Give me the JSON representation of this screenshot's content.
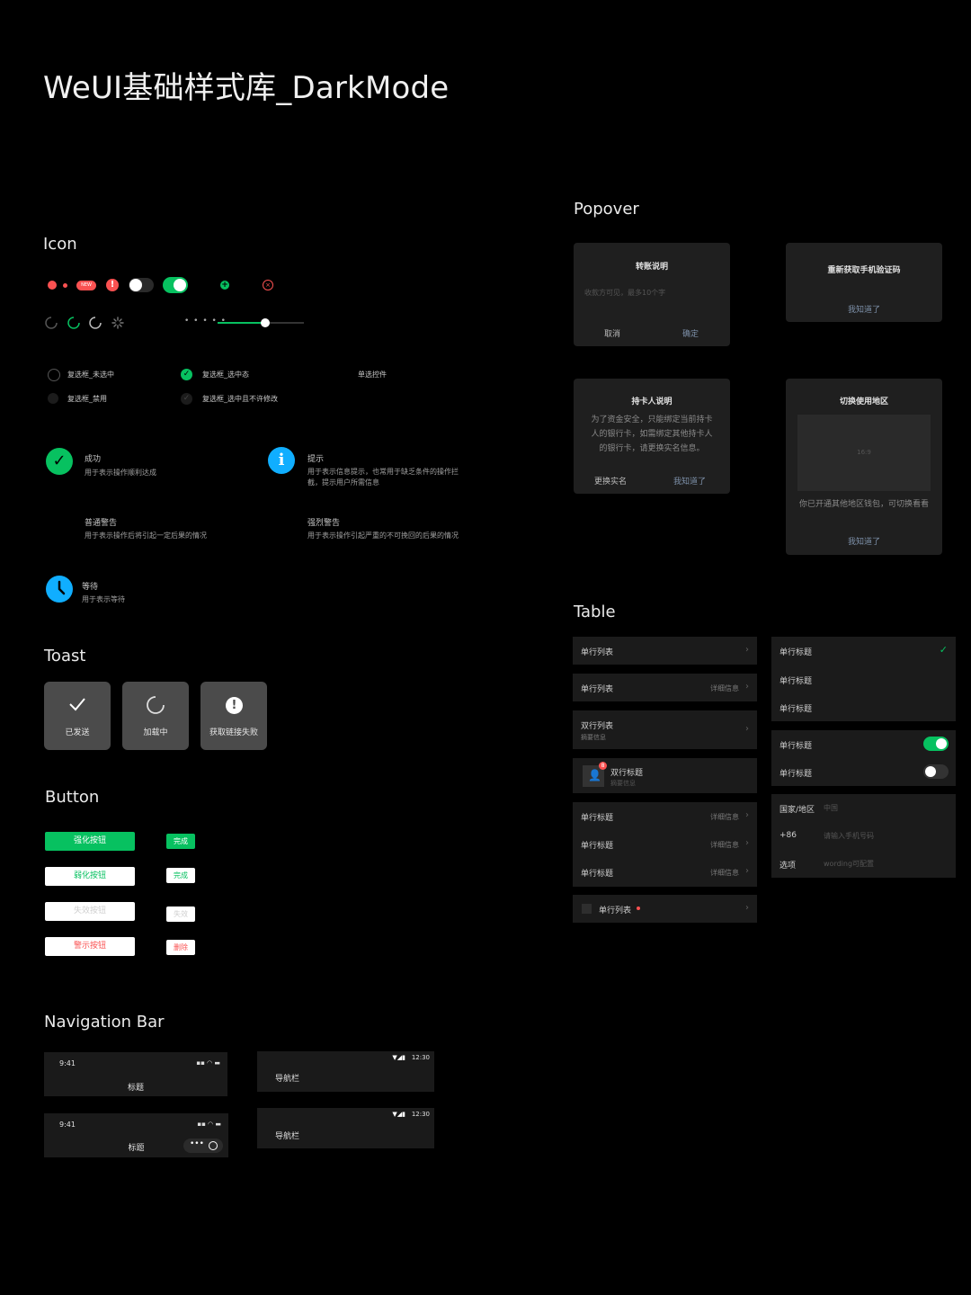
{
  "page_title": "WeUI基础样式库_DarkMode",
  "sections": {
    "icon": "Icon",
    "toast": "Toast",
    "button": "Button",
    "navbar": "Navigation Bar",
    "popover": "Popover",
    "table": "Table"
  },
  "icon_section": {
    "new_badge": "NEW",
    "checkboxes": [
      {
        "label": "复选框_未选中"
      },
      {
        "label": "复选框_选中态"
      },
      {
        "label": "单选控件"
      },
      {
        "label": "复选框_禁用"
      },
      {
        "label": "复选框_选中且不许修改"
      }
    ],
    "messages": [
      {
        "title": "成功",
        "desc": "用于表示操作顺利达成"
      },
      {
        "title": "提示",
        "desc1": "用于表示信息提示，也常用于缺乏条件的操作拦",
        "desc2": "截，提示用户所需信息"
      },
      {
        "title": "普通警告",
        "desc": "用于表示操作后将引起一定后果的情况"
      },
      {
        "title": "强烈警告",
        "desc": "用于表示操作引起严重的不可挽回的后果的情况"
      },
      {
        "title": "等待",
        "desc": "用于表示等待"
      }
    ]
  },
  "toasts": [
    {
      "label": "已发送",
      "icon": "check-icon"
    },
    {
      "label": "加载中",
      "icon": "loading-icon"
    },
    {
      "label": "获取链接失败",
      "icon": "warn-icon"
    }
  ],
  "buttons": {
    "primary": "强化按钮",
    "primary_mini": "完成",
    "default": "弱化按钮",
    "default_mini": "完成",
    "disabled": "失效按钮",
    "disabled_mini": "失效",
    "warn": "警示按钮",
    "warn_mini": "删除"
  },
  "navbars": {
    "ios_time": "9:41",
    "title": "标题",
    "android_time": "12:30",
    "android_title": "导航栏"
  },
  "popovers": [
    {
      "title": "转账说明",
      "placeholder": "收款方可见，最多10个字",
      "cancel": "取消",
      "confirm": "确定"
    },
    {
      "title": "重新获取手机验证码",
      "confirm": "我知道了"
    },
    {
      "title": "持卡人说明",
      "line1": "为了资金安全，只能绑定当前持卡",
      "line2": "人的银行卡，如需绑定其他持卡人",
      "line3": "的银行卡，请更换实名信息。",
      "cancel": "更换实名",
      "confirm": "我知道了"
    },
    {
      "title": "切换使用地区",
      "image_label": "16:9",
      "text": "你已开通其他地区钱包，可切换看看",
      "confirm": "我知道了"
    }
  ],
  "table_left": {
    "row1": "单行列表",
    "row2": "单行列表",
    "row2_detail": "详细信息",
    "row3_title": "双行列表",
    "row3_sub": "摘要信息",
    "row4_title": "双行标题",
    "row4_sub": "摘要信息",
    "badge": "8",
    "group": [
      {
        "label": "单行标题",
        "detail": "详细信息"
      },
      {
        "label": "单行标题",
        "detail": "详细信息"
      },
      {
        "label": "单行标题",
        "detail": "详细信息"
      }
    ],
    "row_last": "单行列表"
  },
  "table_right": {
    "check_group": [
      "单行标题",
      "单行标题",
      "单行标题"
    ],
    "switch_group": [
      "单行标题",
      "单行标题"
    ],
    "form": {
      "country_label": "国家/地区",
      "country_value": "中国",
      "phone_prefix": "+86",
      "phone_placeholder": "请输入手机号码",
      "option_label": "选项",
      "option_value": "wording可配置"
    }
  },
  "colors": {
    "brand_green": "#07c160",
    "warn_red": "#fa5151",
    "info_blue": "#10aeff",
    "background": "#000000",
    "cell_background": "#1b1b1b"
  }
}
